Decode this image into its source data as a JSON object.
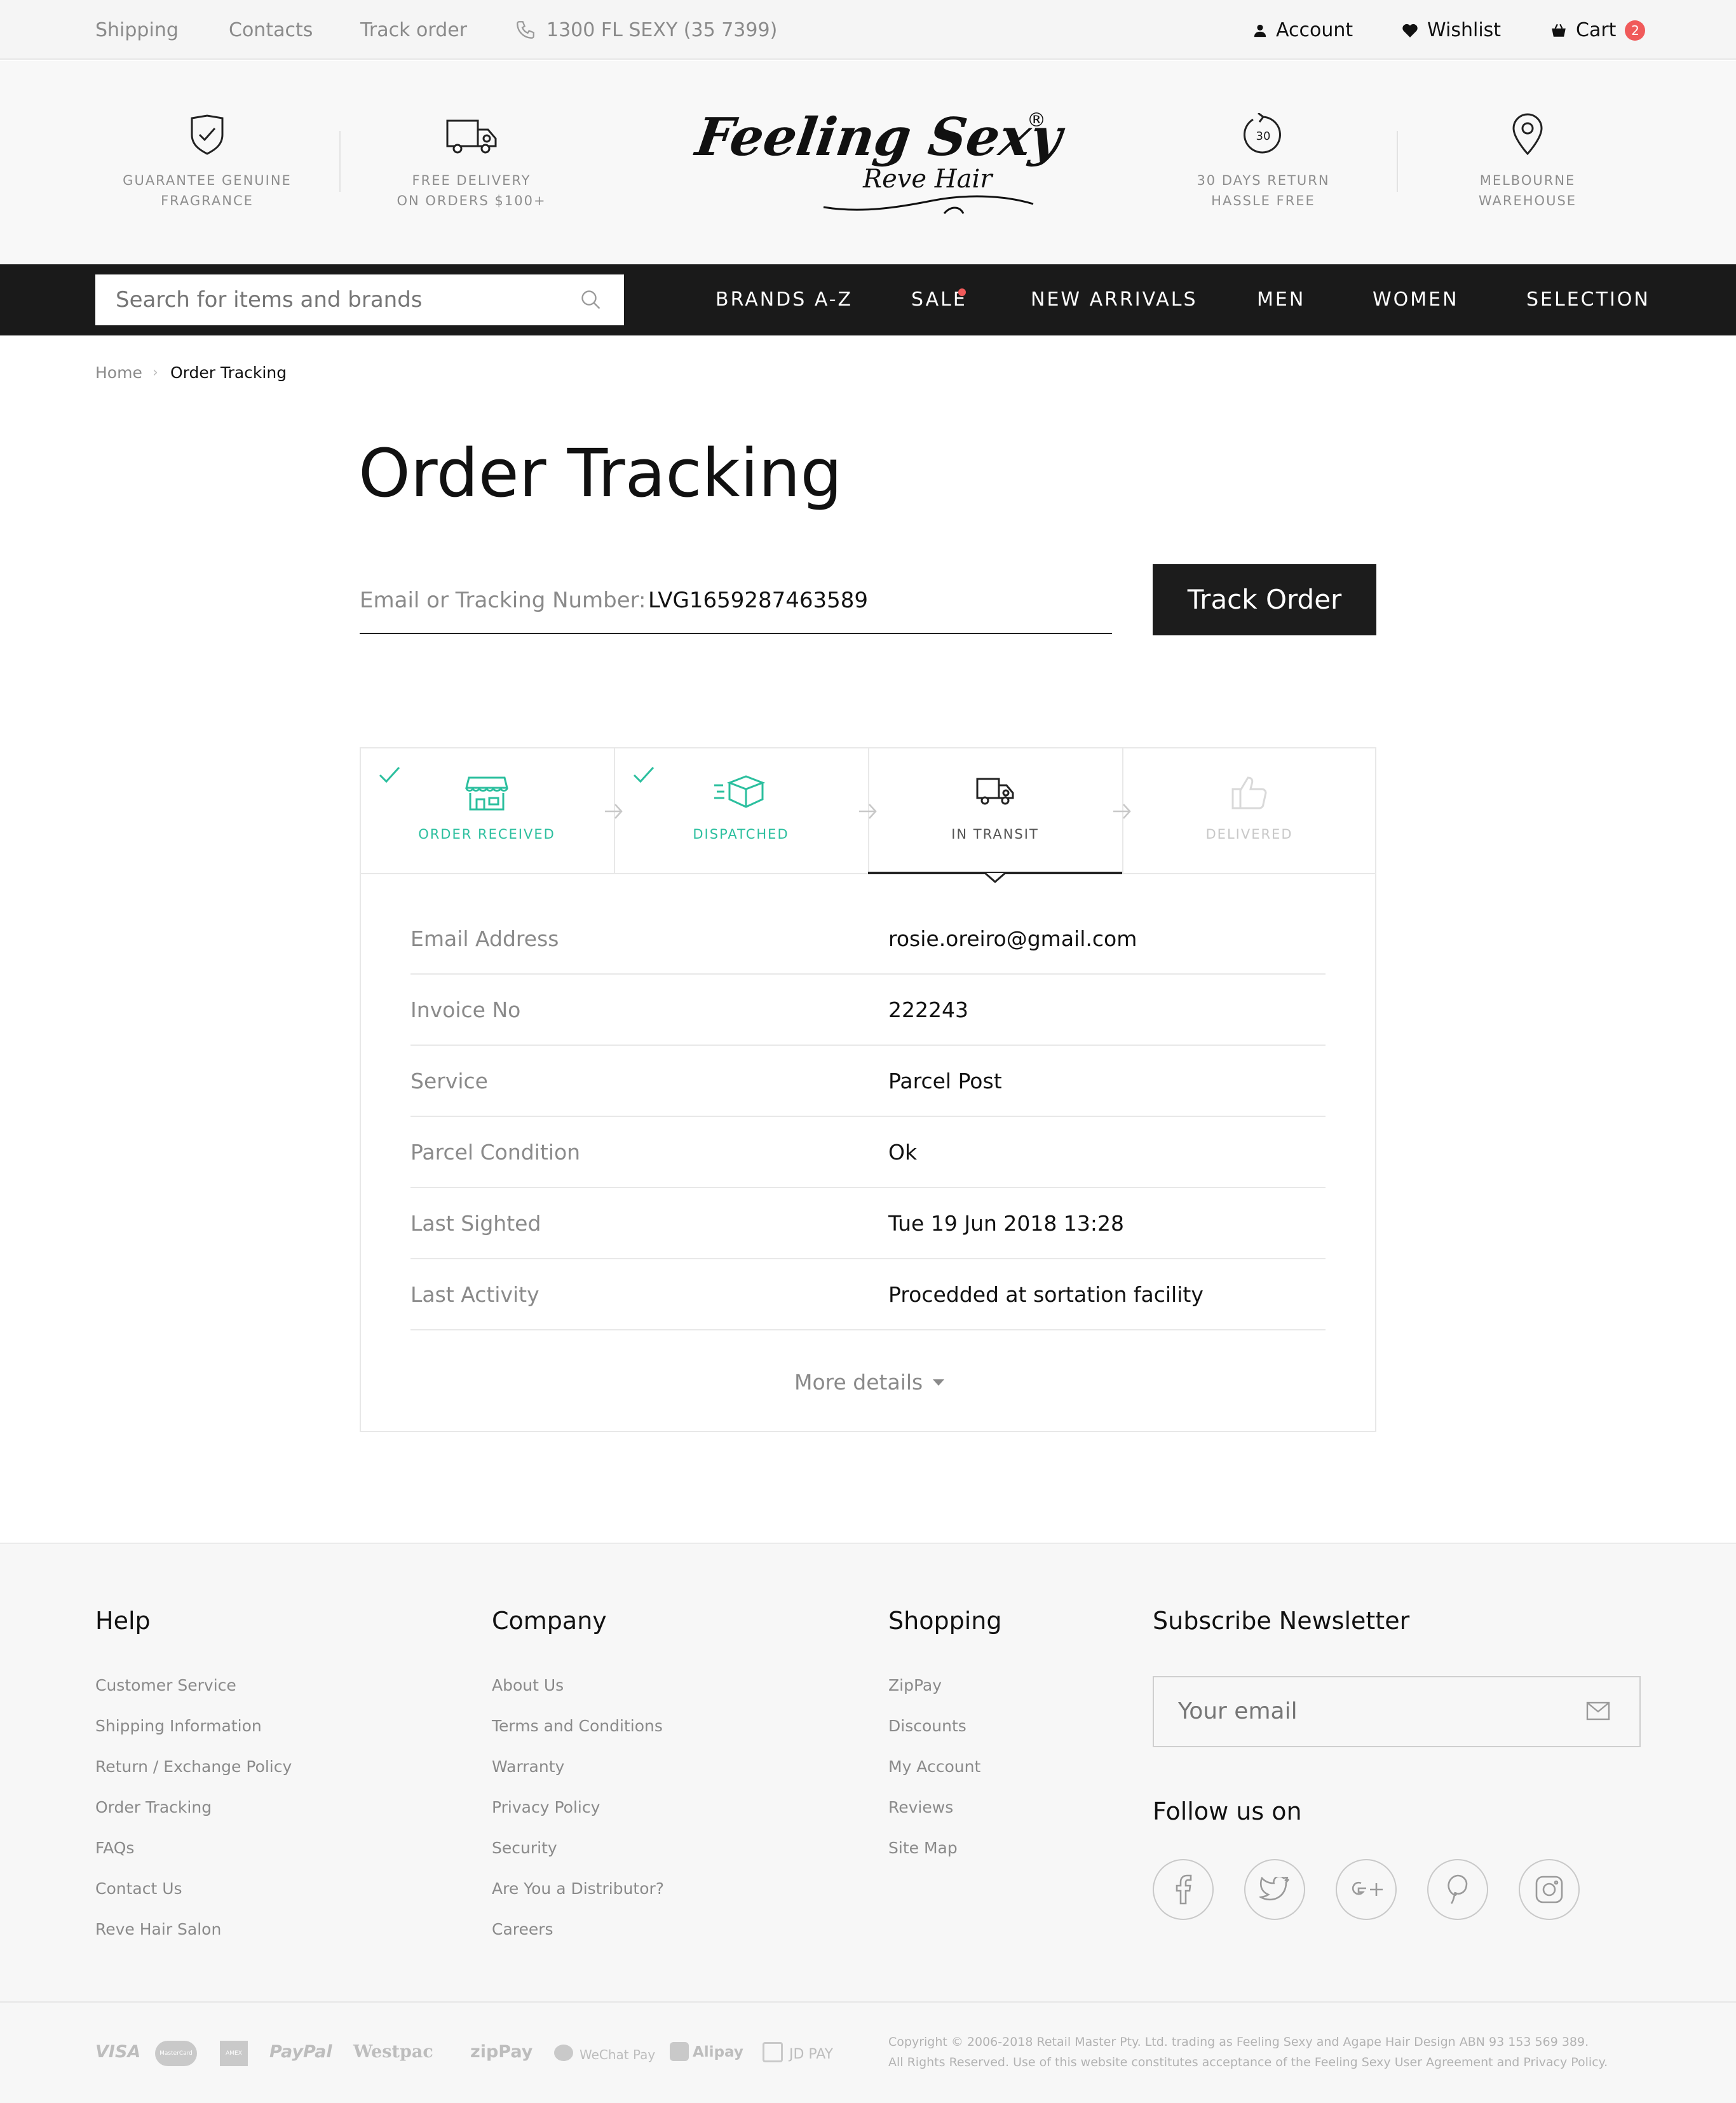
{
  "topbar": {
    "links": [
      "Shipping",
      "Contacts",
      "Track order"
    ],
    "phone": "1300 FL SEXY (35 7399)",
    "account": "Account",
    "wishlist": "Wishlist",
    "cart": "Cart",
    "cart_count": "2"
  },
  "header": {
    "features": [
      {
        "icon": "shield-check-icon",
        "line1": "GUARANTEE GENUINE",
        "line2": "FRAGRANCE"
      },
      {
        "icon": "truck-icon",
        "line1": "FREE DELIVERY",
        "line2": "ON ORDERS $100+"
      },
      {
        "icon": "return-30-icon",
        "line1": "30 DAYS RETURN",
        "line2": "HASSLE FREE",
        "badge": "30"
      },
      {
        "icon": "map-pin-icon",
        "line1": "MELBOURNE",
        "line2": "WAREHOUSE"
      }
    ],
    "logo": {
      "line1": "Feeling Sexy",
      "line2": "Reve Hair",
      "mark": "®"
    }
  },
  "nav": {
    "search_placeholder": "Search for items and brands",
    "items": [
      "BRANDS A-Z",
      "SALE",
      "NEW ARRIVALS",
      "MEN",
      "WOMEN",
      "SELECTION"
    ],
    "sale_dot_color": "#f05a5a"
  },
  "breadcrumb": {
    "home": "Home",
    "current": "Order Tracking"
  },
  "page": {
    "title": "Order Tracking",
    "field_label": "Email or Tracking Number:",
    "field_value": "LVG1659287463589",
    "button": "Track Order"
  },
  "tracking": {
    "steps": [
      {
        "label": "ORDER RECEIVED",
        "icon": "store-icon",
        "state": "done"
      },
      {
        "label": "DISPATCHED",
        "icon": "box-icon",
        "state": "done"
      },
      {
        "label": "IN TRANSIT",
        "icon": "truck-icon",
        "state": "active"
      },
      {
        "label": "DELIVERED",
        "icon": "thumbs-up-icon",
        "state": "pending"
      }
    ],
    "done_color": "#2bbf9e",
    "rows": [
      {
        "label": "Email Address",
        "value": "rosie.oreiro@gmail.com"
      },
      {
        "label": "Invoice No",
        "value": "222243"
      },
      {
        "label": "Service",
        "value": "Parcel Post"
      },
      {
        "label": "Parcel Condition",
        "value": "Ok"
      },
      {
        "label": "Last Sighted",
        "value": "Tue 19 Jun 2018 13:28"
      },
      {
        "label": "Last Activity",
        "value": "Procedded at sortation facility"
      }
    ],
    "more": "More details"
  },
  "footer": {
    "help": {
      "title": "Help",
      "links": [
        "Customer Service",
        "Shipping Information",
        "Return / Exchange Policy",
        "Order Tracking",
        "FAQs",
        "Contact Us",
        "Reve Hair Salon"
      ]
    },
    "company": {
      "title": "Company",
      "links": [
        "About Us",
        "Terms and Conditions",
        "Warranty",
        "Privacy Policy",
        "Security",
        "Are You a Distributor?",
        "Careers"
      ]
    },
    "shopping": {
      "title": "Shopping",
      "links": [
        "ZipPay",
        "Discounts",
        "My Account",
        "Reviews",
        "Site Map"
      ]
    },
    "newsletter": {
      "title": "Subscribe Newsletter",
      "placeholder": "Your email",
      "follow": "Follow us on"
    },
    "social": [
      "facebook-icon",
      "twitter-icon",
      "google-plus-icon",
      "pinterest-icon",
      "instagram-icon"
    ],
    "payments": [
      "VISA",
      "MasterCard",
      "AMEX",
      "PayPal",
      "Westpac",
      "zipPay",
      "WeChat Pay",
      "Alipay",
      "JD PAY"
    ],
    "copyright1": "Copyright © 2006-2018 Retail Master Pty. Ltd. trading as Feeling Sexy and Agape Hair Design ABN 93 153 569 389.",
    "copyright2": "All Rights Reserved. Use of this website constitutes acceptance of the Feeling Sexy User Agreement and Privacy Policy."
  }
}
